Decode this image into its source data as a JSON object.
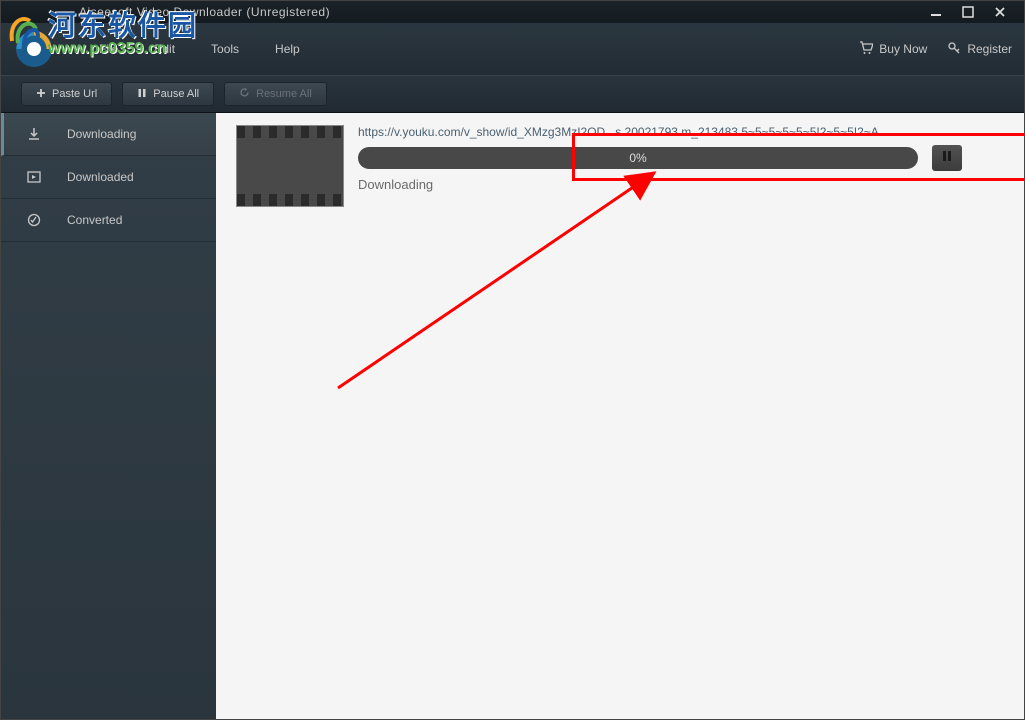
{
  "window": {
    "title": "Aiseesoft Video Downloader (Unregistered)"
  },
  "menu": {
    "items": [
      "File",
      "Edit",
      "Tools",
      "Help"
    ]
  },
  "header_links": {
    "buy": "Buy Now",
    "register": "Register"
  },
  "toolbar": {
    "paste_url": "Paste Url",
    "pause_all": "Pause All",
    "resume_all": "Resume All"
  },
  "sidebar": {
    "items": [
      {
        "label": "Downloading",
        "icon": "download-icon"
      },
      {
        "label": "Downloaded",
        "icon": "downloaded-icon"
      },
      {
        "label": "Converted",
        "icon": "converted-icon"
      }
    ]
  },
  "downloads": [
    {
      "url": "https://v.youku.com/v_show/id_XMzg3MzI2OD...s.20021793.m_213483.5~5~5~5~5~5!2~5~5!2~A",
      "progress_text": "0%",
      "status": "Downloading"
    }
  ],
  "watermark": {
    "line1": "河东软件园",
    "line2": "www.pc0359.cn"
  }
}
